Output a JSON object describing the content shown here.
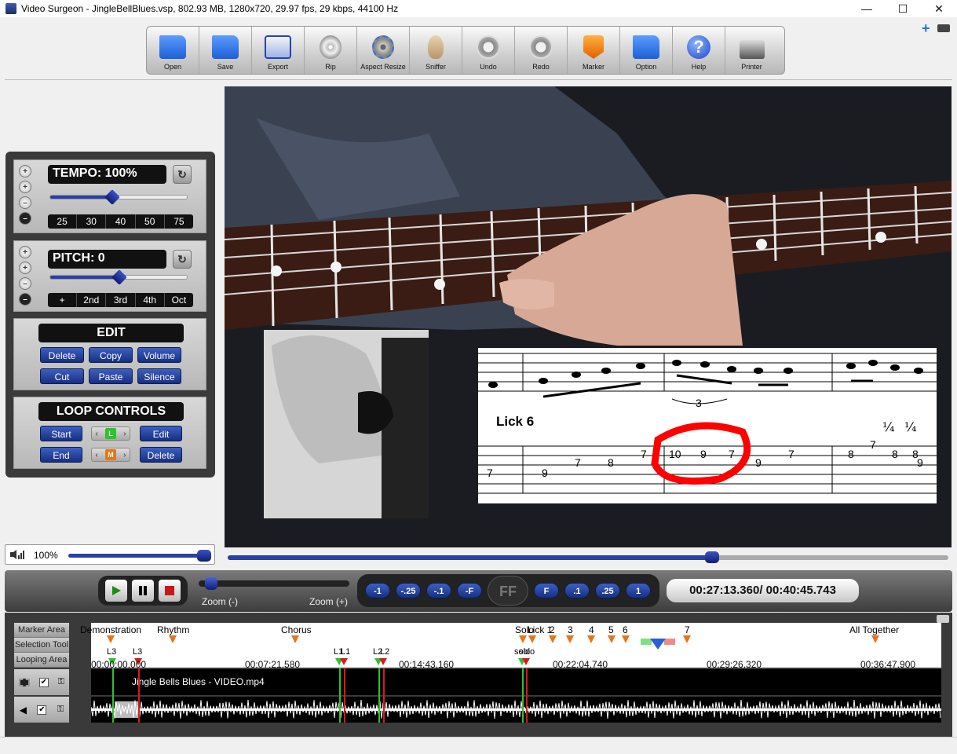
{
  "window": {
    "title": "Video Surgeon - JingleBellBlues.vsp, 802.93 MB, 1280x720, 29.97 fps, 29 kbps, 44100 Hz",
    "minimize": "—",
    "maximize": "☐",
    "close": "✕"
  },
  "toolbar": {
    "open": "Open",
    "save": "Save",
    "export": "Export",
    "rip": "Rip",
    "aspect": "Aspect Resize",
    "sniffer": "Sniffer",
    "undo": "Undo",
    "redo": "Redo",
    "marker": "Marker",
    "option": "Option",
    "help": "Help",
    "printer": "Printer"
  },
  "tempo": {
    "readout": "TEMPO: 100%",
    "level": 0.45,
    "presets": [
      "25",
      "30",
      "40",
      "50",
      "75"
    ]
  },
  "pitch": {
    "readout": "PITCH: 0",
    "level": 0.5,
    "presets": [
      "+",
      "2nd",
      "3rd",
      "4th",
      "Oct"
    ]
  },
  "edit": {
    "title": "EDIT",
    "delete": "Delete",
    "copy": "Copy",
    "volume": "Volume",
    "cut": "Cut",
    "paste": "Paste",
    "silence": "Silence"
  },
  "loop": {
    "title": "LOOP CONTROLS",
    "start": "Start",
    "edit": "Edit",
    "end": "End",
    "delete": "Delete",
    "tag_l": "L",
    "tag_m": "M"
  },
  "volume": {
    "label": "100%",
    "level": 1.0
  },
  "seek": {
    "level": 0.67
  },
  "transport": {
    "zoom_out": "Zoom (-)",
    "zoom_in": "Zoom (+)",
    "steps": [
      "-1",
      "-.25",
      "-.1",
      "-F",
      "F",
      ".1",
      ".25",
      "1"
    ],
    "ff": "FF",
    "timecode": "00:27:13.360/ 00:40:45.743"
  },
  "video": {
    "lick_label": "Lick 6",
    "quarter": "¼",
    "triplet": "3",
    "tab_numbers": [
      "7",
      "9",
      "7",
      "8",
      "7",
      "10",
      "9",
      "7",
      "9",
      "7",
      "8",
      "7",
      "8",
      "8",
      "9"
    ]
  },
  "timeline": {
    "labels": [
      "Marker Area",
      "Selection Tool",
      "Looping Area"
    ],
    "markers": [
      "Demonstration",
      "Rhythm",
      "Chorus",
      "Solo",
      "Lick 1",
      "2",
      "3",
      "4",
      "5",
      "6",
      "7",
      "All Together"
    ],
    "loops": [
      "L3",
      "L3",
      "L1",
      "L1",
      "L2",
      "L2",
      "solo",
      "solo"
    ],
    "timecodes": [
      "00:00:00.000",
      "00:07:21.580",
      "00:14:43.160",
      "00:22:04.740",
      "00:29:26.320",
      "00:36:47.900"
    ],
    "video_track": "Jingle Bells Blues - VIDEO.mp4",
    "check": "✔"
  },
  "colors": {
    "accent_blue": "#2a3fa8",
    "marker_orange": "#e8741a",
    "loop_green": "#2ec22e",
    "loop_red": "#d81a1a",
    "circle_red": "#ff0000"
  }
}
